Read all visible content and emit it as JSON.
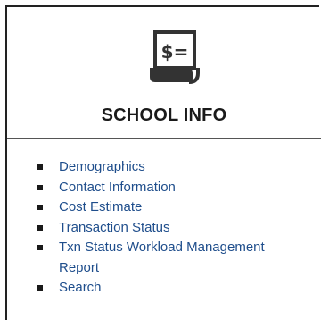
{
  "panel": {
    "icon": "receipt-dollar-icon",
    "icon_glyph": "$=",
    "title": "SCHOOL INFO"
  },
  "links": [
    {
      "label": "Demographics"
    },
    {
      "label": "Contact Information"
    },
    {
      "label": "Cost Estimate"
    },
    {
      "label": "Transaction Status"
    },
    {
      "label": "Txn Status Workload Management Report"
    },
    {
      "label": "Search"
    }
  ],
  "colors": {
    "link": "#1f4e8c",
    "icon": "#333333",
    "border": "#222222"
  }
}
